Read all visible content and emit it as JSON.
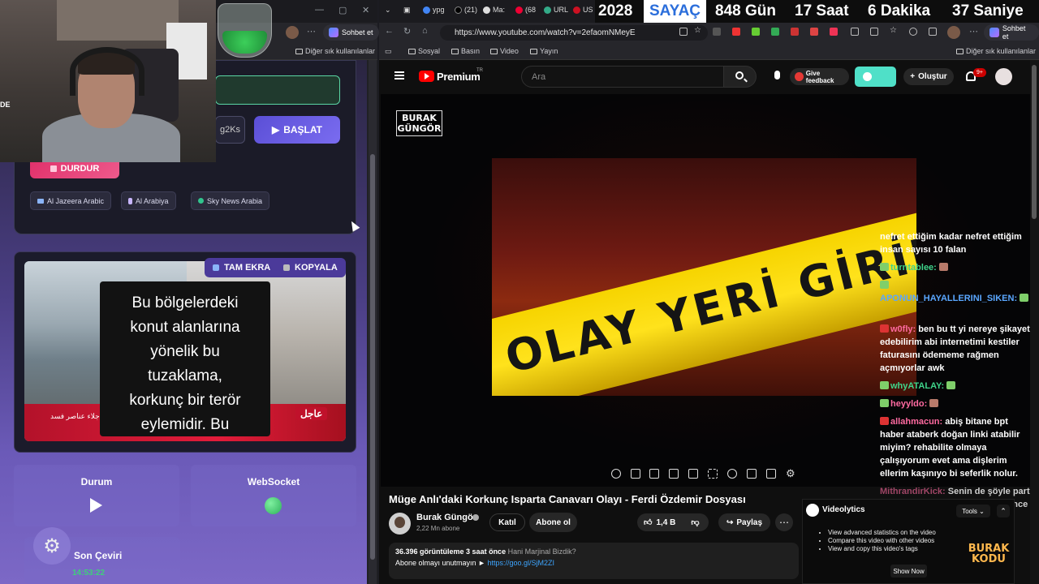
{
  "left_browser": {
    "chat_button": "Sohbet et",
    "bookmark_other": "Diğer sık kullanılanlar",
    "webcam_label": "DE"
  },
  "translator_app": {
    "key_field_value": "g2Ks",
    "start_button": "BAŞLAT",
    "stop_button": "DURDUR",
    "sources": [
      {
        "label": "Al Jazeera Arabic"
      },
      {
        "label": "Al Arabiya"
      },
      {
        "label": "Sky News Arabia"
      }
    ],
    "preview": {
      "fullscreen_button": "TAM EKRA",
      "copy_button": "KOPYALA",
      "caption_lines": [
        "Bu bölgelerdeki",
        "konut alanlarına",
        "yönelik bu",
        "tuzaklama,",
        "korkunç bir terör",
        "eylemidir. Bu"
      ],
      "news_badge": "عاجل",
      "ticker_text": "ن إجلاء عناصر فسد"
    },
    "status": {
      "status_title": "Durum",
      "websocket_title": "WebSocket",
      "last_translation_title": "Son Çeviri",
      "last_translation_time": "14:53:22"
    }
  },
  "right_browser": {
    "tabs": [
      {
        "label": "ypg"
      },
      {
        "label": "(21)"
      },
      {
        "label": "Ma:"
      },
      {
        "label": "(68"
      },
      {
        "label": "URL"
      },
      {
        "label": "US"
      }
    ],
    "counter": {
      "year": "2028",
      "label": "SAYAÇ",
      "days": "848 Gün",
      "hours": "17 Saat",
      "minutes": "6 Dakika",
      "seconds": "37 Saniye"
    },
    "url": "https://www.youtube.com/watch?v=2efaomNMeyE",
    "chat_button": "Sohbet et",
    "bookmarks": [
      "Sosyal",
      "Basın",
      "Video",
      "Yayın"
    ],
    "bookmark_other": "Diğer sık kullanılanlar"
  },
  "youtube": {
    "logo_text": "Premium",
    "region": "TR",
    "search_placeholder": "Ara",
    "feedback_button": "Give feedback",
    "create_button": "Oluştur",
    "notification_count": "9+",
    "channel_watermark": [
      "BURAK",
      "GÜNGÖR"
    ],
    "tape_text": "OLAY YERİ GİRİLMEZ",
    "video_title": "Müge Anlı'daki Korkunç Isparta Canavarı Olayı - Ferdi Özdemir Dosyası",
    "channel_name": "Burak Güngör",
    "subscribers": "2,22 Mn abone",
    "join_button": "Katıl",
    "subscribe_button": "Abone ol",
    "likes": "1,4 B",
    "share_button": "Paylaş",
    "views": "36.396 görüntüleme",
    "published": "3 saat önce",
    "hashtag": "Hani Marjinal Bizdik?",
    "desc_line": "Abone olmayı unutmayın ►",
    "desc_link": "https://goo.gl/SjM2ZI"
  },
  "live_chat": [
    {
      "name": "",
      "text": "nefret ettiğim kadar nefret ettiğim insan sayısı 10 falan"
    },
    {
      "name": "turntablee:",
      "text": ""
    },
    {
      "name": "APONUN_HAYALLERINI_SIKEN:",
      "text": ""
    },
    {
      "name": "w0fly:",
      "text": "ben bu tt yi nereye şikayet edebilirim abi internetimi kestiler faturasını ödememe rağmen açmıyorlar awk"
    },
    {
      "name": "whyATALAY:",
      "text": ""
    },
    {
      "name": "heyyldo:",
      "text": ""
    },
    {
      "name": "allahmacun:",
      "text": "abiş bitane bpt haber ataberk doğan linki atabilir miyim? rehabilite olmaya çalışıyorum evet ama dişlerim ellerim kaşınıyo bi seferlik nolur."
    },
    {
      "name": "MithrandirKick:",
      "text": "Senin de şöyle part videolar çekmen lazım kaç ay önce söylemiştim."
    }
  ],
  "videolytics": {
    "title": "Videolytics",
    "tools_button": "Tools",
    "features": [
      "View advanced statistics on the video",
      "Compare this video with other videos",
      "View and copy this video's tags"
    ],
    "show_button": "Show Now"
  },
  "brand_badge": [
    "BURAK",
    "KODU"
  ]
}
